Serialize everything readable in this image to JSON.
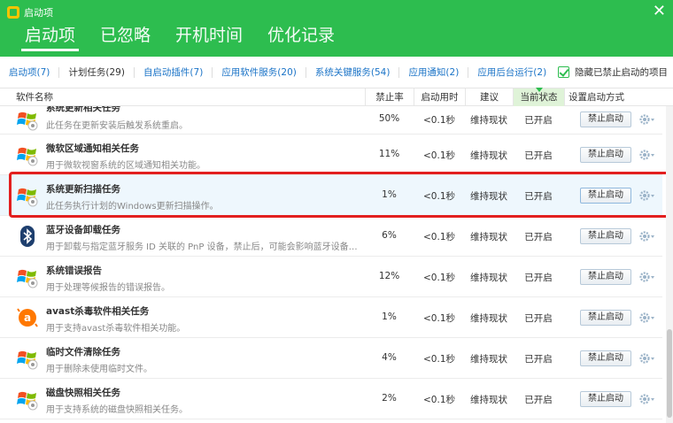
{
  "window": {
    "title": "启动项",
    "close_glyph": "✕"
  },
  "tabs": [
    {
      "label": "启动项",
      "active": true
    },
    {
      "label": "已忽略"
    },
    {
      "label": "开机时间"
    },
    {
      "label": "优化记录"
    }
  ],
  "subnav": {
    "items": [
      "启动项(7)",
      "计划任务(29)",
      "自启动插件(7)",
      "应用软件服务(20)",
      "系统关键服务(54)",
      "应用通知(2)",
      "应用后台运行(2)"
    ],
    "active_index": 1,
    "hide_label": "隐藏已禁止启动的项目"
  },
  "table": {
    "columns": [
      "软件名称",
      "禁止率",
      "启动用时",
      "建议",
      "当前状态",
      "设置启动方式"
    ],
    "rows": [
      {
        "icon": "windows-icon",
        "name": "系统更新相关任务",
        "desc": "此任务在更新安装后触发系统重启。",
        "rate": "50%",
        "time": "<0.1秒",
        "advice": "维持现状",
        "status": "已开启",
        "button": "禁止启动"
      },
      {
        "icon": "windows-icon",
        "name": "微软区域通知相关任务",
        "desc": "用于微软视窗系统的区域通知相关功能。",
        "rate": "11%",
        "time": "<0.1秒",
        "advice": "维持现状",
        "status": "已开启",
        "button": "禁止启动"
      },
      {
        "icon": "windows-icon",
        "name": "系统更新扫描任务",
        "desc": "此任务执行计划的Windows更新扫描操作。",
        "rate": "1%",
        "time": "<0.1秒",
        "advice": "维持现状",
        "status": "已开启",
        "button": "禁止启动",
        "selected": true
      },
      {
        "icon": "bluetooth-icon",
        "name": "蓝牙设备卸载任务",
        "desc": "用于卸载与指定蓝牙服务 ID 关联的 PnP 设备，禁止后，可能会影响蓝牙设备的...",
        "rate": "6%",
        "time": "<0.1秒",
        "advice": "维持现状",
        "status": "已开启",
        "button": "禁止启动"
      },
      {
        "icon": "windows-icon",
        "name": "系统错误报告",
        "desc": "用于处理等候报告的错误报告。",
        "rate": "12%",
        "time": "<0.1秒",
        "advice": "维持现状",
        "status": "已开启",
        "button": "禁止启动"
      },
      {
        "icon": "avast-icon",
        "name": "avast杀毒软件相关任务",
        "desc": "用于支持avast杀毒软件相关功能。",
        "rate": "1%",
        "time": "<0.1秒",
        "advice": "维持现状",
        "status": "已开启",
        "button": "禁止启动"
      },
      {
        "icon": "windows-icon",
        "name": "临时文件清除任务",
        "desc": "用于删除未使用临时文件。",
        "rate": "4%",
        "time": "<0.1秒",
        "advice": "维持现状",
        "status": "已开启",
        "button": "禁止启动"
      },
      {
        "icon": "windows-icon",
        "name": "磁盘快照相关任务",
        "desc": "用于支持系统的磁盘快照相关任务。",
        "rate": "2%",
        "time": "<0.1秒",
        "advice": "维持现状",
        "status": "已开启",
        "button": "禁止启动"
      }
    ]
  },
  "colors": {
    "accent": "#2dbd4f",
    "link": "#1a73c7",
    "highlight": "#e21f1f"
  }
}
